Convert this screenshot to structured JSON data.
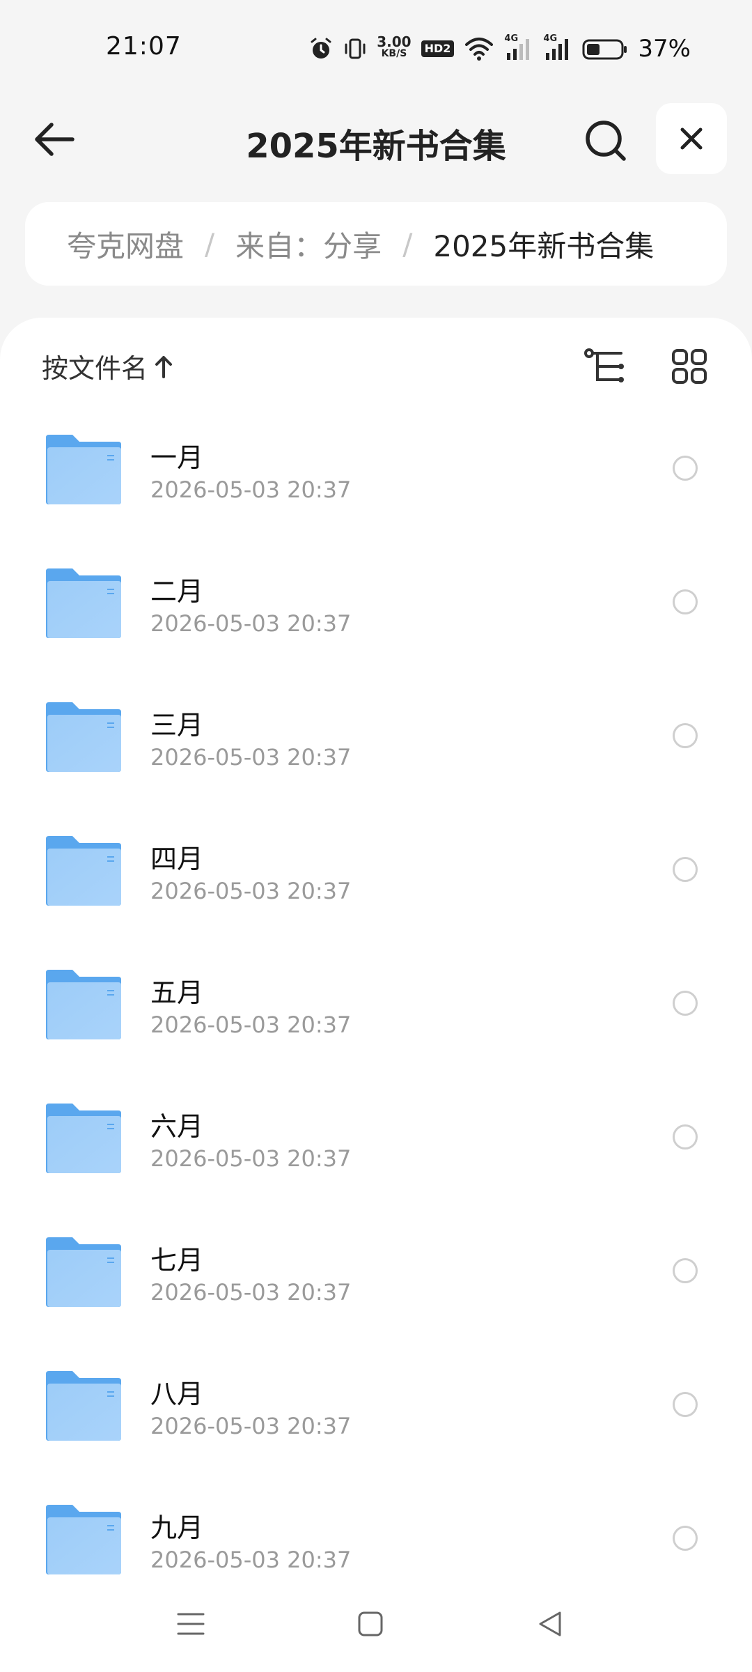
{
  "status_bar": {
    "time": "21:07",
    "net_speed_value": "3.00",
    "net_speed_unit": "KB/S",
    "hd_label": "HD2",
    "signal_1_label": "4G",
    "signal_2_label": "4G",
    "battery_percent": "37%"
  },
  "title_bar": {
    "title": "2025年新书合集",
    "icons": {
      "back": "arrow-left-icon",
      "search": "search-icon",
      "close": "close-icon"
    }
  },
  "breadcrumb": {
    "items": [
      "夸克网盘",
      "来自：分享",
      "2025年新书合集"
    ],
    "separator": "/"
  },
  "sort_bar": {
    "label": "按文件名",
    "direction_icon": "arrow-up-icon",
    "icons": {
      "tree": "tree-view-icon",
      "grid": "grid-view-icon"
    }
  },
  "files": [
    {
      "name": "一月",
      "date": "2026-05-03 20:37"
    },
    {
      "name": "二月",
      "date": "2026-05-03 20:37"
    },
    {
      "name": "三月",
      "date": "2026-05-03 20:37"
    },
    {
      "name": "四月",
      "date": "2026-05-03 20:37"
    },
    {
      "name": "五月",
      "date": "2026-05-03 20:37"
    },
    {
      "name": "六月",
      "date": "2026-05-03 20:37"
    },
    {
      "name": "七月",
      "date": "2026-05-03 20:37"
    },
    {
      "name": "八月",
      "date": "2026-05-03 20:37"
    },
    {
      "name": "九月",
      "date": "2026-05-03 20:37"
    }
  ],
  "colors": {
    "folder_dark": "#5aa7ee",
    "folder_light": "#a9d3fa",
    "background": "#f5f5f5",
    "panel": "#ffffff"
  },
  "nav_bar": {
    "icons": [
      "menu-icon",
      "home-icon",
      "back-triangle-icon"
    ]
  }
}
